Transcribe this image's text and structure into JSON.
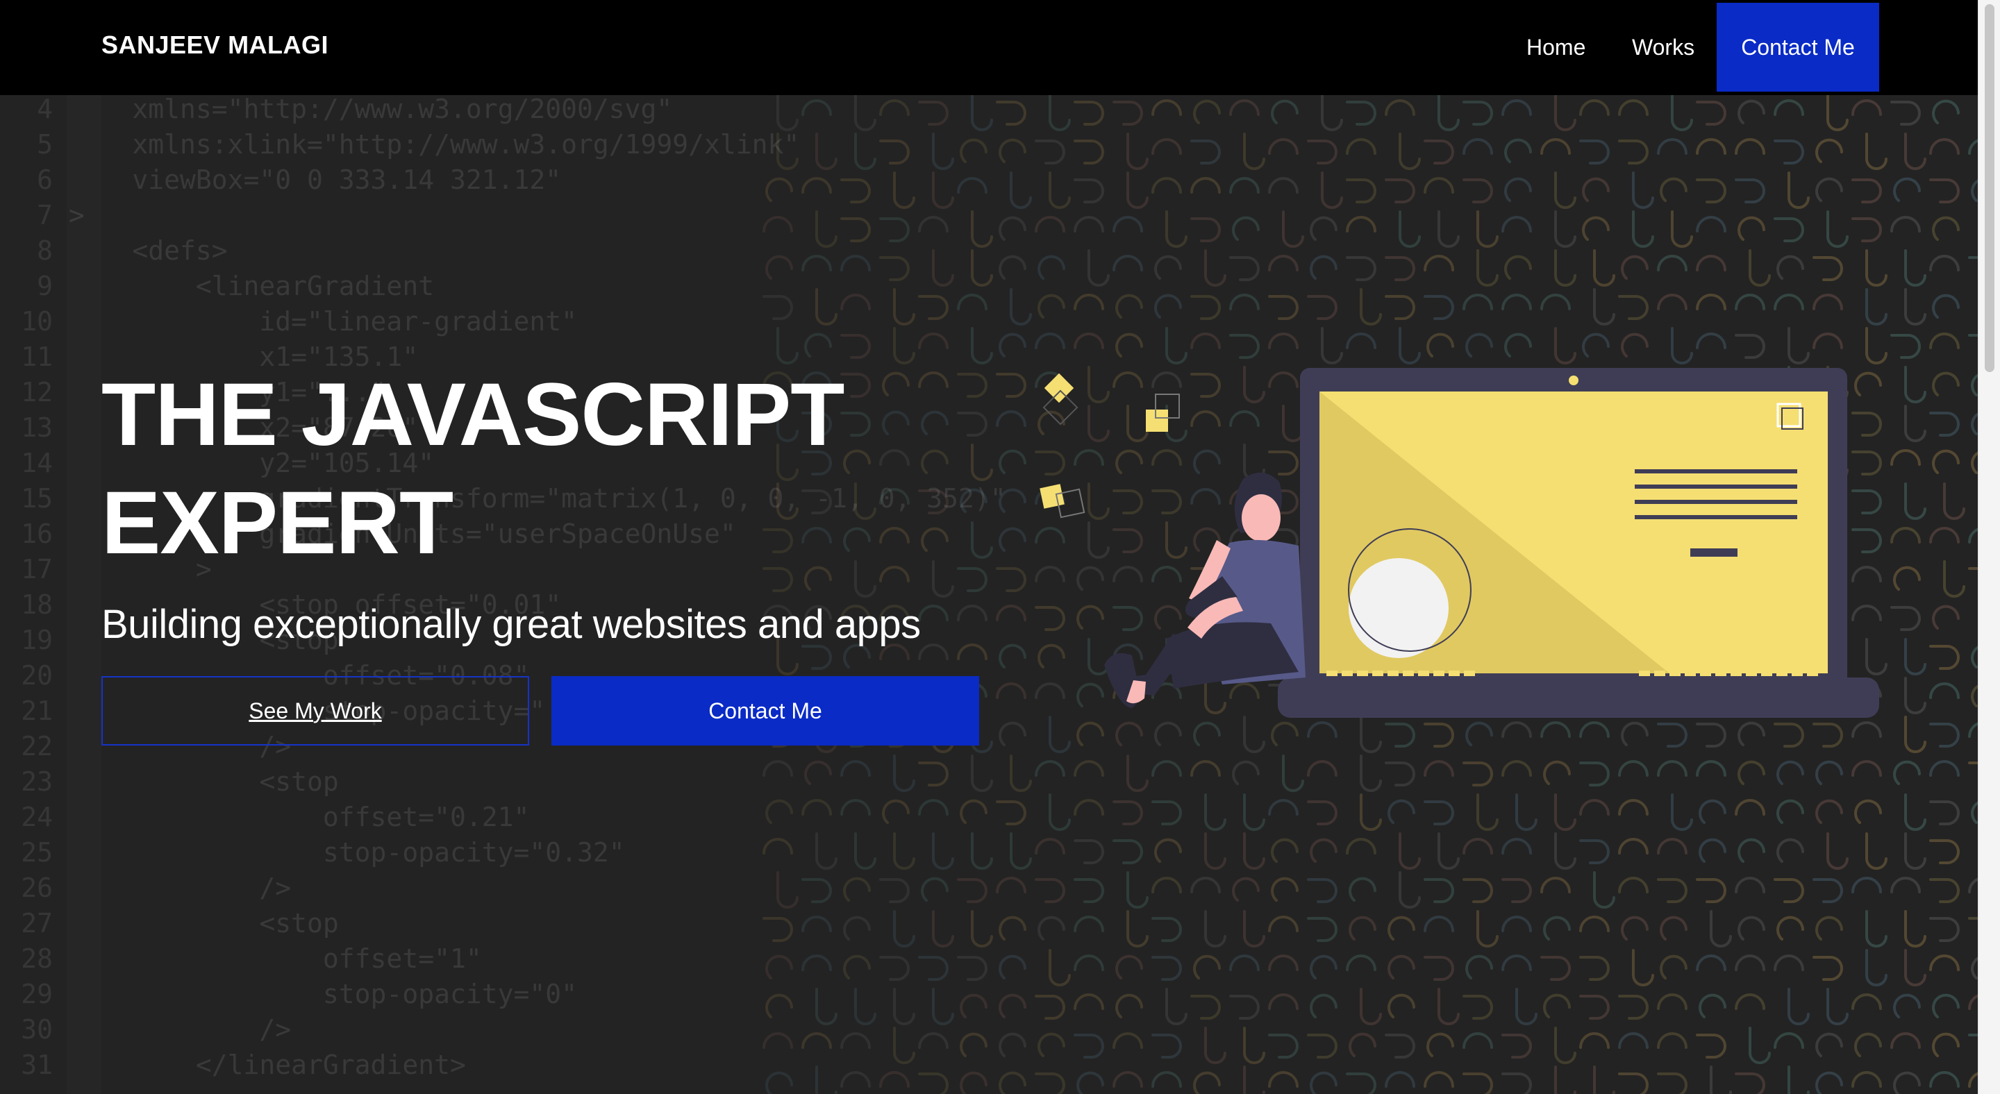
{
  "nav": {
    "brand": "SANJEEV MALAGI",
    "links": [
      {
        "label": "Home"
      },
      {
        "label": "Works"
      },
      {
        "label": "Contact Me"
      }
    ]
  },
  "hero": {
    "headline_line1": "THE JAVASCRIPT",
    "headline_line2": "EXPERT",
    "tagline": "Building exceptionally great websites and apps",
    "primary_button": "See My Work",
    "secondary_button": "Contact Me"
  },
  "code_lines": [
    {
      "n": "4",
      "text": "    xmlns=\"http://www.w3.org/2000/svg\""
    },
    {
      "n": "5",
      "text": "    xmlns:xlink=\"http://www.w3.org/1999/xlink\""
    },
    {
      "n": "6",
      "text": "    viewBox=\"0 0 333.14 321.12\""
    },
    {
      "n": "7",
      "text": ">"
    },
    {
      "n": "8",
      "text": "    <defs>"
    },
    {
      "n": "9",
      "text": "        <linearGradient"
    },
    {
      "n": "10",
      "text": "            id=\"linear-gradient\""
    },
    {
      "n": "11",
      "text": "            x1=\"135.1\""
    },
    {
      "n": "12",
      "text": "            y1=\"...\""
    },
    {
      "n": "13",
      "text": "            x2=\"87.26\""
    },
    {
      "n": "14",
      "text": "            y2=\"105.14\""
    },
    {
      "n": "15",
      "text": "            gradientTransform=\"matrix(1, 0, 0, -1, 0, 352)\""
    },
    {
      "n": "16",
      "text": "            gradientUnits=\"userSpaceOnUse\""
    },
    {
      "n": "17",
      "text": "        >"
    },
    {
      "n": "18",
      "text": "            <stop offset=\"0.01\""
    },
    {
      "n": "19",
      "text": "            <stop"
    },
    {
      "n": "20",
      "text": "                offset=\"0.08\""
    },
    {
      "n": "21",
      "text": "                stop-opacity=\"...\""
    },
    {
      "n": "22",
      "text": "            />"
    },
    {
      "n": "23",
      "text": "            <stop"
    },
    {
      "n": "24",
      "text": "                offset=\"0.21\""
    },
    {
      "n": "25",
      "text": "                stop-opacity=\"0.32\""
    },
    {
      "n": "26",
      "text": "            />"
    },
    {
      "n": "27",
      "text": "            <stop"
    },
    {
      "n": "28",
      "text": "                offset=\"1\""
    },
    {
      "n": "29",
      "text": "                stop-opacity=\"0\""
    },
    {
      "n": "30",
      "text": "            />"
    },
    {
      "n": "31",
      "text": "        </linearGradient>"
    }
  ],
  "colors": {
    "accent": "#0a2bc6",
    "laptop_screen": "#f5df72",
    "laptop_body": "#3f3d56",
    "background": "#232323"
  },
  "icons": {
    "illustration": "person-with-laptop-illustration"
  }
}
